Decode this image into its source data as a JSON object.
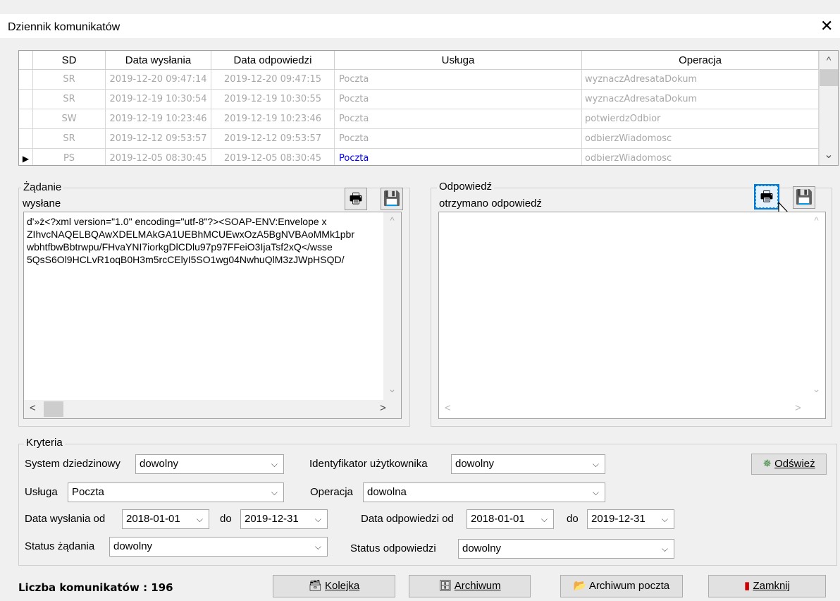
{
  "window": {
    "title": "Dziennik komunikatów",
    "close_glyph": "✕"
  },
  "grid": {
    "columns": [
      "SD",
      "Data wysłania",
      "Data odpowiedzi",
      "Usługa",
      "Operacja"
    ],
    "rows": [
      {
        "sd": "SR",
        "sent": "2019-12-20 09:47:14",
        "reply": "2019-12-20 09:47:15",
        "service": "Poczta",
        "operation": "wyznaczAdresataDokum",
        "current": false
      },
      {
        "sd": "SR",
        "sent": "2019-12-19 10:30:54",
        "reply": "2019-12-19 10:30:55",
        "service": "Poczta",
        "operation": "wyznaczAdresataDokum",
        "current": false
      },
      {
        "sd": "SW",
        "sent": "2019-12-19 10:23:46",
        "reply": "2019-12-19 10:23:46",
        "service": "Poczta",
        "operation": "potwierdzOdbior",
        "current": false
      },
      {
        "sd": "SR",
        "sent": "2019-12-12 09:53:57",
        "reply": "2019-12-12 09:53:57",
        "service": "Poczta",
        "operation": "odbierzWiadomosc",
        "current": false
      },
      {
        "sd": "PS",
        "sent": "2019-12-05 08:30:45",
        "reply": "2019-12-05 08:30:45",
        "service": "Poczta",
        "operation": "odbierzWiadomosc",
        "current": true
      }
    ],
    "row_pointer": "▶",
    "scroll_up": "^",
    "scroll_down": "⌄"
  },
  "request": {
    "group_label": "Żądanie",
    "status": "wysłane",
    "lines": [
      "d'»ż<?xml version=\"1.0\" encoding=\"utf-8\"?><SOAP-ENV:Envelope x",
      "ZIhvcNAQELBQAwXDELMAkGA1UEBhMCUEwxOzA5BgNVBAoMMk1pbr",
      "wbhtfbwBbtrwpu/FHvaYNI7iorkgDlCDlu97p97FFeiO3IjaTsf2xQ</wsse",
      "5QsS6Ol9HCLvR1oqB0H3m5rcCElyI5SO1wg04NwhuQlM3zJWpHSQD/"
    ],
    "print_icon": "🖶",
    "save_icon": "💾",
    "scroll_left": "<",
    "scroll_right": ">",
    "scroll_up": "^",
    "scroll_down": "⌄"
  },
  "response": {
    "group_label": "Odpowiedź",
    "status": "otrzymano odpowiedź",
    "print_icon": "🖶",
    "save_icon": "💾",
    "scroll_left": "<",
    "scroll_right": ">",
    "scroll_up": "^",
    "scroll_down": "⌄"
  },
  "criteria": {
    "group_label": "Kryteria",
    "system_label": "System dziedzinowy",
    "system_value": "dowolny",
    "user_label": "Identyfikator użytkownika",
    "user_value": "dowolny",
    "refresh_label": "Odśwież",
    "service_label": "Usługa",
    "service_value": "Poczta",
    "operation_label": "Operacja",
    "operation_value": "dowolna",
    "sent_from_label": "Data wysłania od",
    "sent_from": "2018-01-01",
    "to_label": "do",
    "sent_to": "2019-12-31",
    "reply_from_label": "Data odpowiedzi od",
    "reply_from": "2018-01-01",
    "reply_to_label": "do",
    "reply_to": "2019-12-31",
    "req_status_label": "Status żądania",
    "req_status_value": "dowolny",
    "resp_status_label": "Status odpowiedzi",
    "resp_status_value": "dowolny",
    "chevron": "⌵"
  },
  "footer": {
    "count_text": "Liczba komunikatów : 196",
    "queue_label": "Kolejka",
    "archive_label": "Archiwum",
    "archive_mail_label": "Archiwum poczta",
    "close_label": "Zamknij"
  }
}
